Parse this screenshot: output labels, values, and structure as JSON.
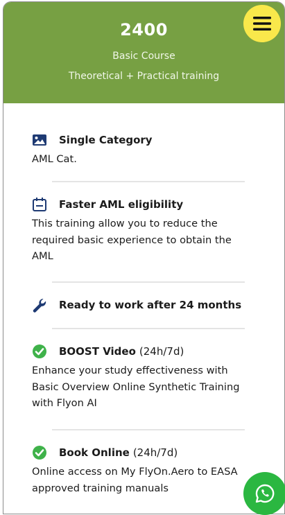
{
  "card": {
    "price": "2400",
    "subtitle": "Basic Course",
    "training_type": "Theoretical + Practical training"
  },
  "features": [
    {
      "icon": "image-icon",
      "title": "Single Category",
      "title_suffix": "",
      "description": "AML Cat."
    },
    {
      "icon": "calendar-icon",
      "title": "Faster AML eligibility",
      "title_suffix": "",
      "description": "This training allow you to reduce the required basic experience to obtain the AML"
    },
    {
      "icon": "wrench-icon",
      "title": "Ready to work after 24 months",
      "title_suffix": "",
      "description": ""
    },
    {
      "icon": "check-circle-icon",
      "title": "BOOST Video",
      "title_suffix": "(24h/7d)",
      "description": "Enhance your study effectiveness with Basic Overview Online Synthetic Training with Flyon AI"
    },
    {
      "icon": "check-circle-icon",
      "title": "Book Online",
      "title_suffix": "(24h/7d)",
      "description": "Online access on My FlyOn.Aero to EASA approved training manuals"
    }
  ],
  "colors": {
    "header_green": "#77a043",
    "icon_navy": "#1e3a73",
    "check_green": "#3fb24a",
    "menu_yellow": "#f9e84b",
    "whatsapp_green": "#2bb741"
  }
}
